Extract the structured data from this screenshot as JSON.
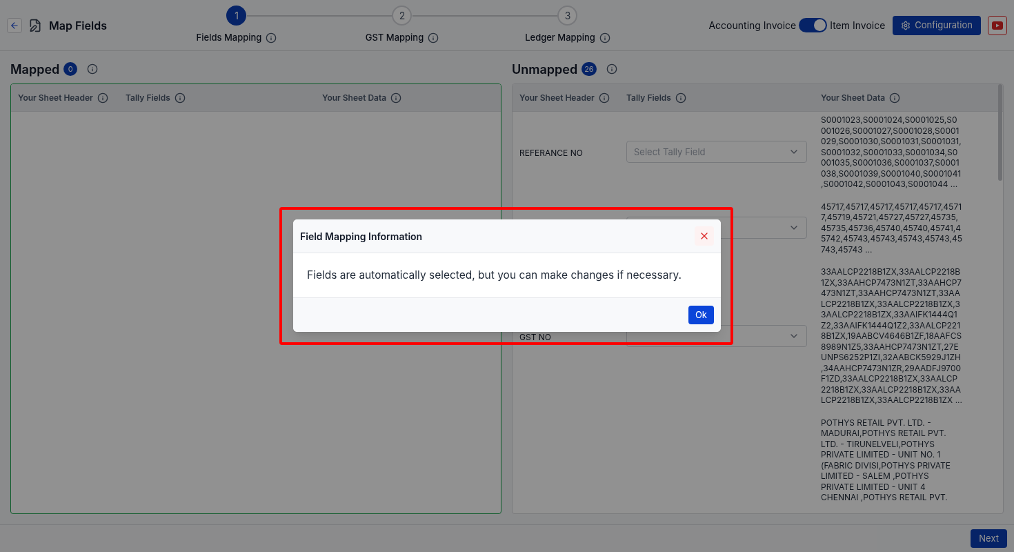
{
  "header": {
    "title": "Map Fields",
    "steps": [
      {
        "number": "1",
        "label": "Fields Mapping",
        "selected": true
      },
      {
        "number": "2",
        "label": "GST Mapping",
        "selected": false
      },
      {
        "number": "3",
        "label": "Ledger Mapping",
        "selected": false
      }
    ],
    "toggle": {
      "left_label": "Accounting Invoice",
      "right_label": "Item Invoice",
      "on": true
    },
    "config_button": "Configuration"
  },
  "mapped": {
    "title": "Mapped",
    "count": "0",
    "columns": [
      "Your Sheet Header",
      "Tally Fields",
      "Your Sheet Data"
    ]
  },
  "unmapped": {
    "title": "Unmapped",
    "count": "26",
    "columns": [
      "Your Sheet Header",
      "Tally Fields",
      "Your Sheet Data"
    ],
    "rows": [
      {
        "header": "REFERANCE NO",
        "select": {
          "placeholder": "Select Tally Field"
        },
        "data": "S0001023,S0001024,S0001025,S0001026,S0001027,S0001028,S0001029,S0001030,S0001031,S0001031,S0001032,S0001033,S0001034,S0001035,S0001036,S0001037,S0001038,S0001039,S0001040,S0001041,S0001042,S0001043,S0001044 ..."
      },
      {
        "select": {},
        "data": "45717,45717,45717,45717,45717,45717,45719,45721,45727,45727,45735,45735,45736,45740,45740,45741,45742,45743,45743,45743,45743,45743,45743 ..."
      },
      {
        "header": "GST NO",
        "select": {},
        "data": "33AALCP2218B1ZX,33AALCP2218B1ZX,33AAHCP7473N1ZT,33AAHCP7473N1ZT,33AAHCP7473N1ZT,33AALCP2218B1ZX,33AALCP2218B1ZX,33AALCP2218B1ZX,33AAIFK1444Q1Z2,33AAIFK1444Q1Z2,33AALCP2218B1ZX,19AABCV4646B1ZF,18AAFCS8989N1Z5,33AAHCP7473N1ZT,27EUNPS6252P1ZI,32AABCK5929J1ZH,34AAHCP7473N1ZR,29AADFJ9700F1ZD,33AALCP2218B1ZX,33AALCP2218B1ZX,33AALCP2218B1ZX,33AALCP2218B1ZX,33AALCP2218B1ZX ..."
      },
      {
        "data": "POTHYS RETAIL PVT. LTD. - MADURAI,POTHYS RETAIL PVT. LTD. - TIRUNELVELI,POTHYS PRIVATE LIMITED - UNIT NO. 1 (FABRIC DIVISI,POTHYS PRIVATE LIMITED - SALEM ,POTHYS PRIVATE LIMITED - UNIT 4 CHENNAI ,POTHYS RETAIL PVT."
      }
    ]
  },
  "footer": {
    "next_button": "Next"
  },
  "dialog": {
    "title": "Field Mapping Information",
    "message": "Fields are automatically selected, but you can make changes if necessary.",
    "ok_button": "Ok"
  }
}
